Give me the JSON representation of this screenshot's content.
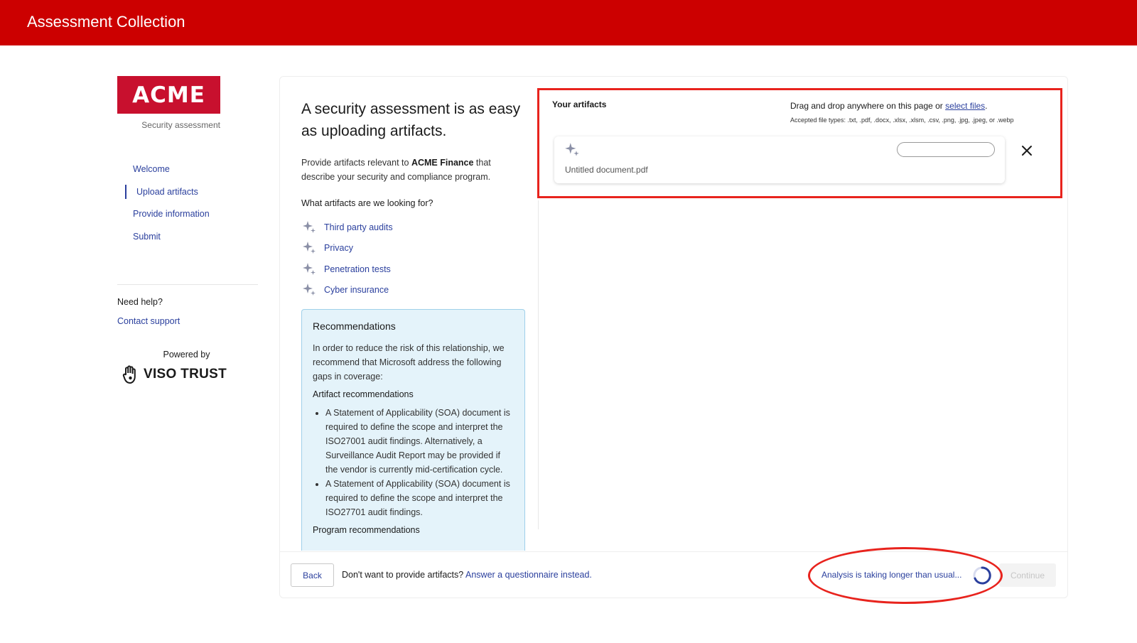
{
  "header": {
    "title": "Assessment Collection"
  },
  "sidebar": {
    "logo_text": "ACME",
    "logo_subtitle": "Security assessment",
    "nav": [
      {
        "label": "Welcome",
        "active": false
      },
      {
        "label": "Upload artifacts",
        "active": true
      },
      {
        "label": "Provide information",
        "active": false
      },
      {
        "label": "Submit",
        "active": false
      }
    ],
    "help_title": "Need help?",
    "help_link": "Contact support",
    "powered_by": "Powered by",
    "brand": "VISO TRUST"
  },
  "main": {
    "heading": "A security assessment is as easy as uploading artifacts.",
    "intro_prefix": "Provide artifacts relevant to ",
    "intro_company": "ACME Finance",
    "intro_suffix": " that describe your security and compliance program.",
    "looking_for": "What artifacts are we looking for?",
    "artifact_types": [
      "Third party audits",
      "Privacy",
      "Penetration tests",
      "Cyber insurance"
    ],
    "recommendations": {
      "title": "Recommendations",
      "intro": "In order to reduce the risk of this relationship, we recommend that Microsoft address the following gaps in coverage:",
      "artifact_heading": "Artifact recommendations",
      "artifact_items": [
        "A Statement of Applicability (SOA) document is required to define the scope and interpret the ISO27001 audit findings. Alternatively, a Surveillance Audit Report may be provided if the vendor is currently mid-certification cycle.",
        "A Statement of Applicability (SOA) document is required to define the scope and interpret the ISO27701 audit findings."
      ],
      "program_heading": "Program recommendations"
    }
  },
  "artifacts": {
    "title": "Your artifacts",
    "drag_text": "Drag and drop anywhere on this page or ",
    "select_link": "select files",
    "drag_suffix": ".",
    "accepted": "Accepted file types: .txt, .pdf, .docx, .xlsx, .xlsm, .csv, .png, .jpg, .jpeg, or .webp",
    "files": [
      {
        "name": "Untitled document.pdf",
        "progress": 0
      }
    ]
  },
  "footer": {
    "back": "Back",
    "dont_text": "Don't want to provide artifacts? ",
    "questionnaire_link": "Answer a questionnaire instead.",
    "analysis_status": "Analysis is taking longer than usual...",
    "continue": "Continue"
  },
  "colors": {
    "brand_red": "#cc0000",
    "link_blue": "#2a3f9d",
    "highlight_red": "#e8231d",
    "reco_bg": "#e4f3fa"
  }
}
